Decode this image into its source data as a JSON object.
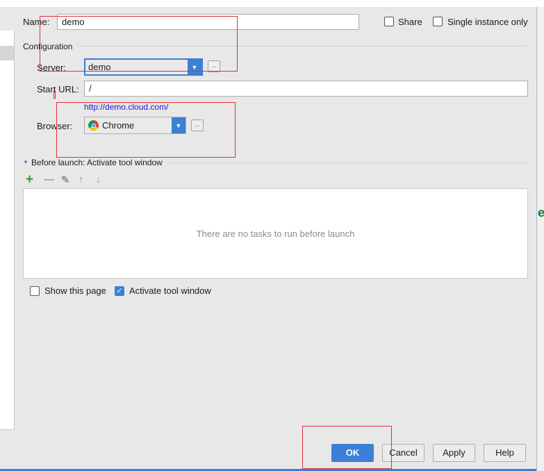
{
  "name_label": "Name:",
  "name_value": "demo",
  "share_label": "Share",
  "single_instance_label": "Single instance only",
  "configuration_label": "Configuration",
  "server_label": "Server:",
  "server_value": "demo",
  "start_url_label": "Start URL:",
  "start_url_value": "/",
  "resolved_url": "http://demo.cloud.com/",
  "browser_label": "Browser:",
  "browser_value": "Chrome",
  "before_launch_label": "Before launch: Activate tool window",
  "empty_tasks_text": "There are no tasks to run before launch",
  "show_page_label": "Show this page",
  "activate_tool_label": "Activate tool window",
  "activate_tool_checked": true,
  "show_page_checked": false,
  "share_checked": false,
  "single_instance_checked": false,
  "buttons": {
    "ok": "OK",
    "cancel": "Cancel",
    "apply": "Apply",
    "help": "Help"
  },
  "ellipsis": "...",
  "right_partial_text": "e",
  "colors": {
    "accent": "#3c7fd6",
    "link": "#1a1adc",
    "annotation": "#e0303c"
  }
}
